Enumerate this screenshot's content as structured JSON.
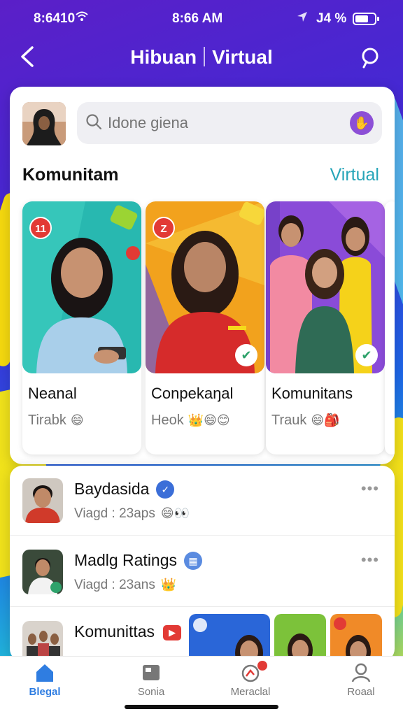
{
  "status_bar": {
    "left_time": "8:6410",
    "center_time": "8:66 AM",
    "battery": "J4 %"
  },
  "header": {
    "title_left": "Hibuan",
    "title_right": "Virtual"
  },
  "search": {
    "placeholder": "Idone giena"
  },
  "section": {
    "title": "Komunitam",
    "link": "Virtual"
  },
  "communities": [
    {
      "name": "Neanal",
      "sub": "Tirabk",
      "emoji": "😄",
      "badge": "11"
    },
    {
      "name": "Conpekaŋal",
      "sub": "Heok",
      "emoji": "👑😄😊",
      "badge": "Z"
    },
    {
      "name": "Komunitans",
      "sub": "Trauk",
      "emoji": "😄🎒"
    }
  ],
  "list": [
    {
      "name": "Baydasida",
      "sub": "Viagd : 23aps",
      "emoji": "😄👀"
    },
    {
      "name": "Madlg Ratings",
      "sub": "Viagd : 23ans",
      "emoji": "👑"
    },
    {
      "name": "Komunittas"
    }
  ],
  "nav": [
    {
      "label": "Blegal",
      "icon": "home-icon",
      "active": true
    },
    {
      "label": "Sonia",
      "icon": "media-icon",
      "active": false
    },
    {
      "label": "Meraclal",
      "icon": "activity-icon",
      "active": false
    },
    {
      "label": "Roaal",
      "icon": "profile-icon",
      "active": false
    }
  ],
  "colors": {
    "accent": "#2f7de1",
    "link": "#26a5b8",
    "badge": "#e23a35",
    "mic": "#8c4fd6"
  }
}
